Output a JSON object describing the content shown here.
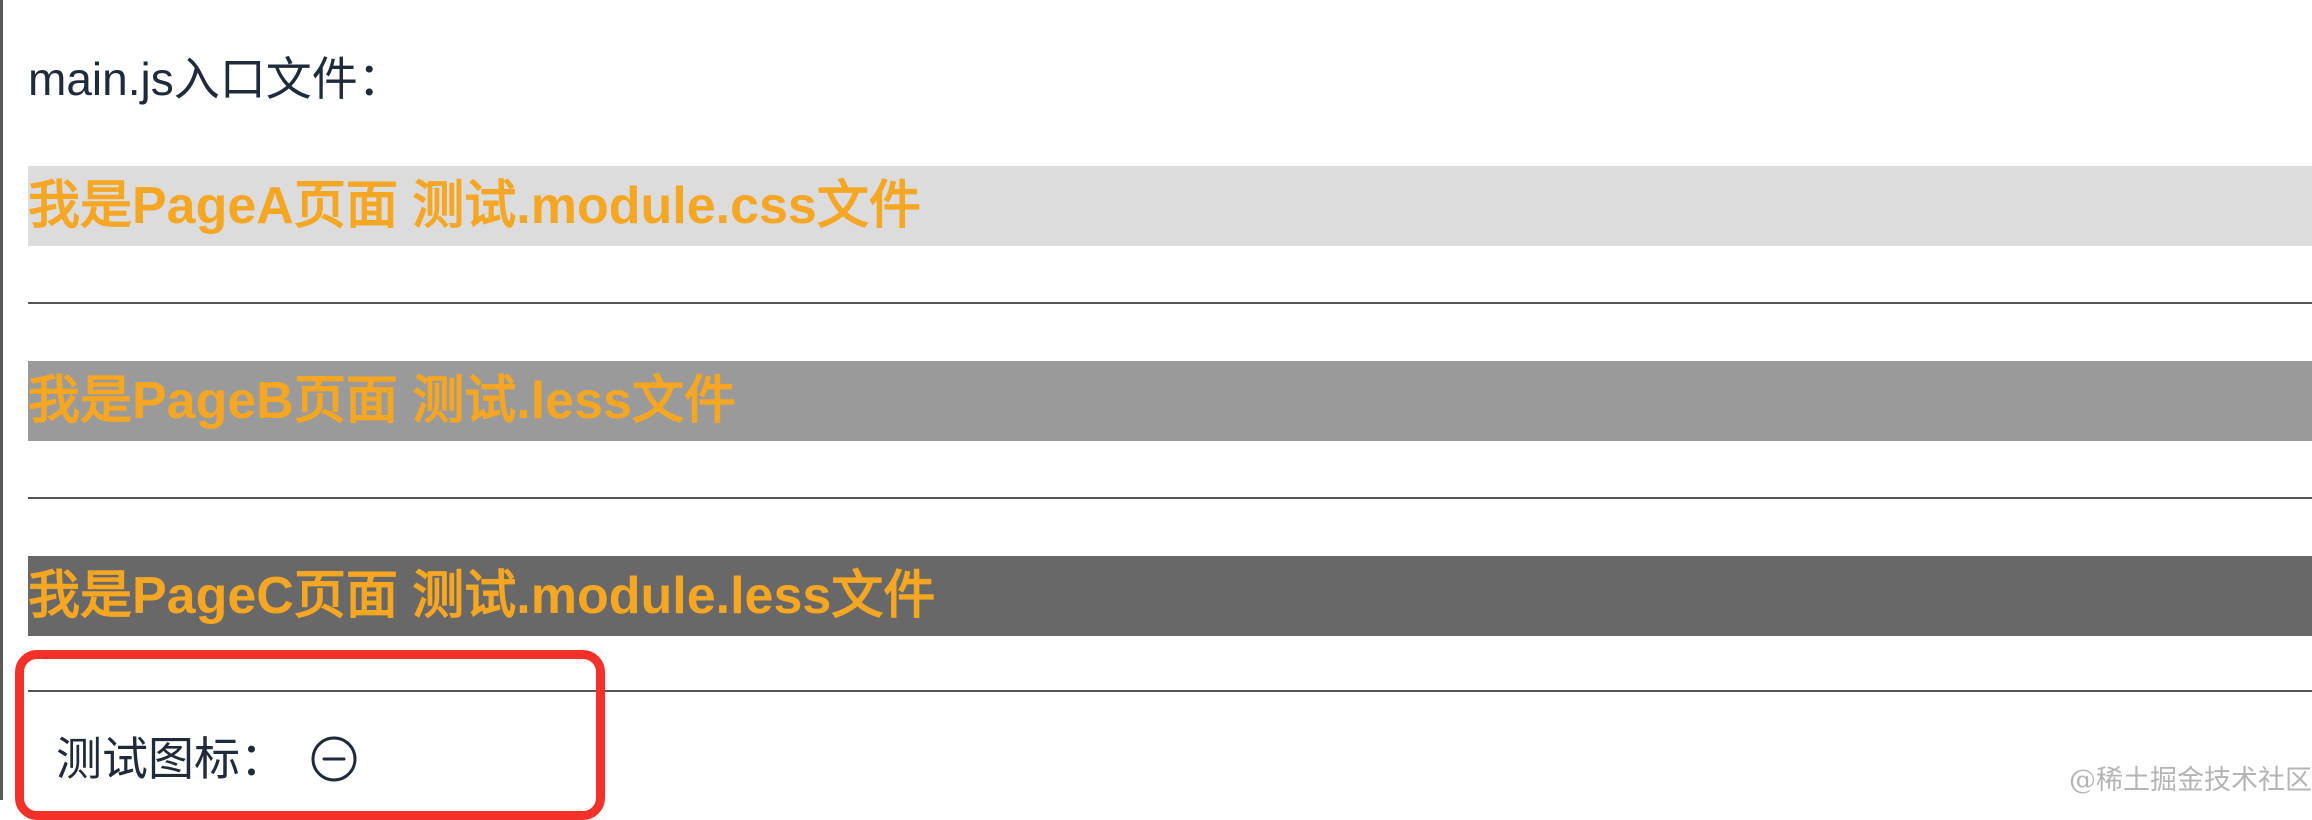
{
  "entry_label": "main.js入口文件：",
  "pages": [
    {
      "title": "我是PageA页面 测试.module.css文件",
      "bg_color": "#dcdcdc"
    },
    {
      "title": "我是PageB页面 测试.less文件",
      "bg_color": "#9a9a9a"
    },
    {
      "title": "我是PageC页面 测试.module.less文件",
      "bg_color": "#686868"
    }
  ],
  "title_color": "#f5a623",
  "icon_test": {
    "label": "测试图标：",
    "icon": "minus-circle-icon"
  },
  "highlight_color": "#f2322a",
  "watermark": "@稀土掘金技术社区"
}
